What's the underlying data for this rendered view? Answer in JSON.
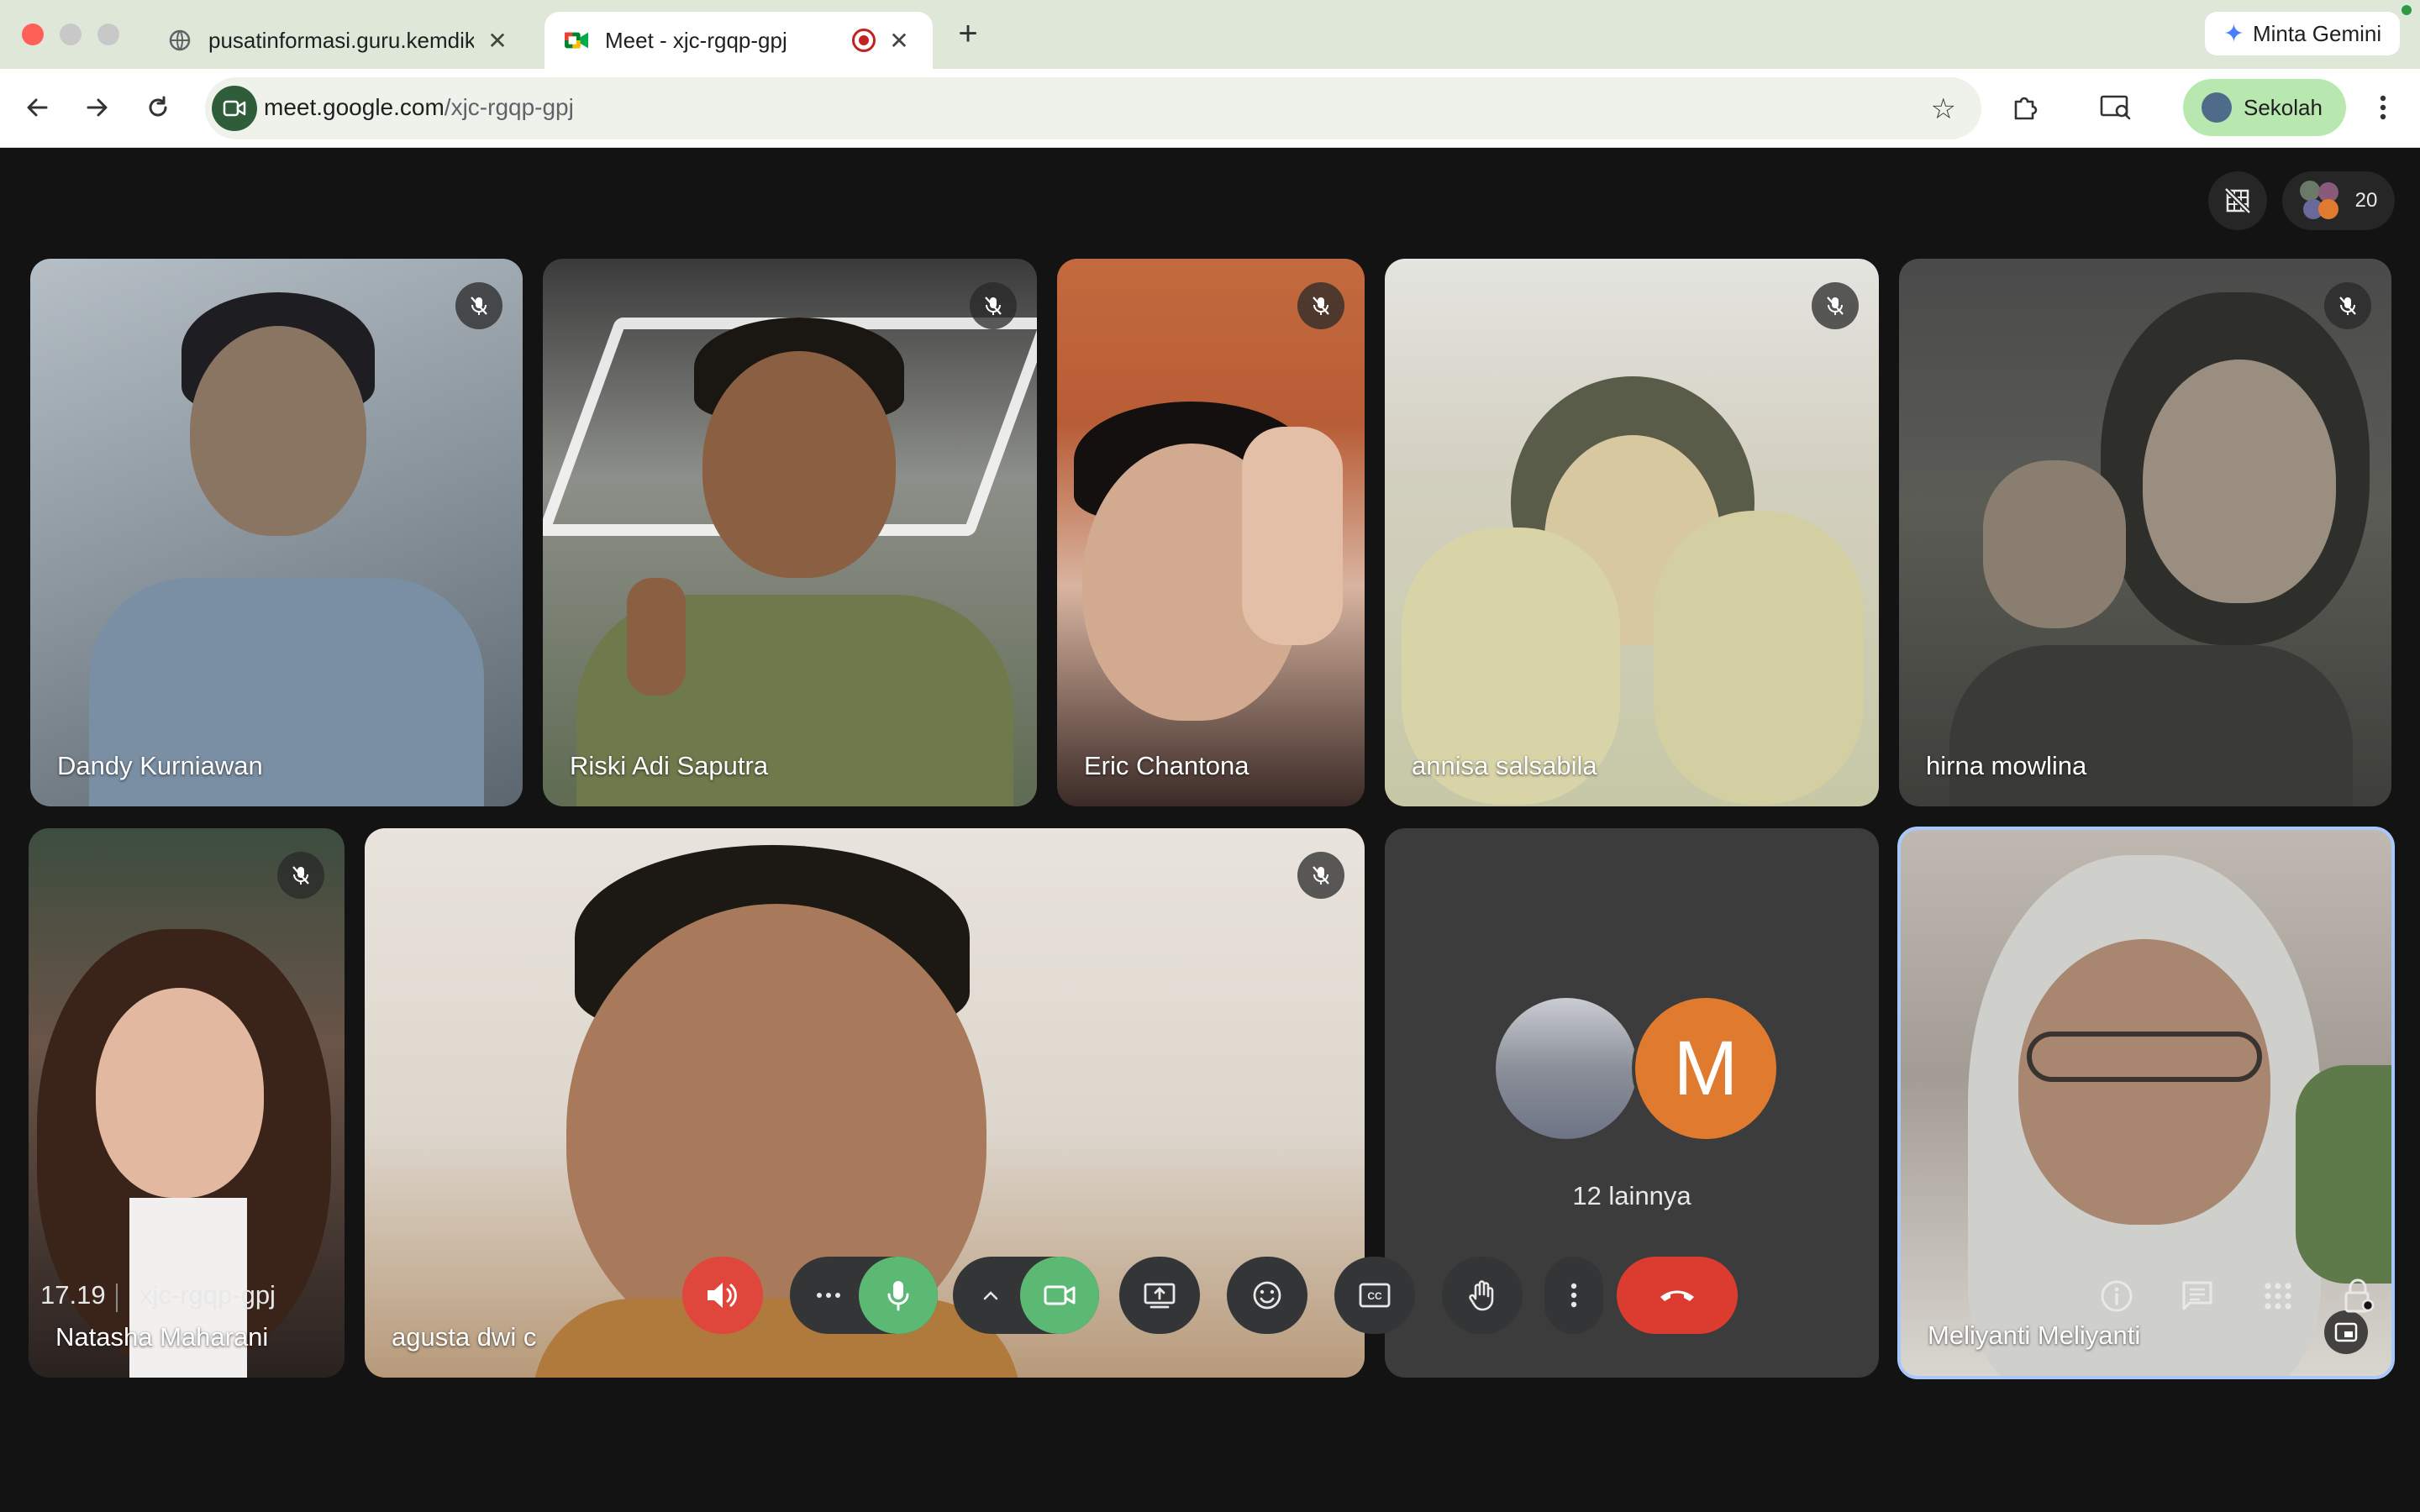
{
  "browser": {
    "tabs": [
      {
        "title": "pusatinformasi.guru.kemdikbud",
        "active": false
      },
      {
        "title": "Meet - xjc-rgqp-gpj",
        "active": true
      }
    ],
    "gemini_label": "Minta Gemini",
    "url_host": "meet.google.com",
    "url_path": "/xjc-rgqp-gpj",
    "profile_label": "Sekolah"
  },
  "meet": {
    "participant_count": "20",
    "tiles": [
      {
        "name": "Dandy Kurniawan",
        "muted": true
      },
      {
        "name": "Riski Adi Saputra",
        "muted": true
      },
      {
        "name": "Eric Chantona",
        "muted": true
      },
      {
        "name": "annisa salsabila",
        "muted": true
      },
      {
        "name": "hirna mowlina",
        "muted": true
      },
      {
        "name": "Natasha Maharani",
        "muted": true
      },
      {
        "name": "agusta dwi c",
        "muted": true
      },
      {
        "name": "Meliyanti Meliyanti",
        "muted": false
      }
    ],
    "others": {
      "avatar_letter": "M",
      "label": "12 lainnya"
    },
    "time": "17.19",
    "meeting_code": "xjc-rgqp-gpj"
  },
  "colors": {
    "accent_green": "#5bb974",
    "leave_red": "#dc3b2f",
    "speaker_red": "#e0473c",
    "avatar_orange": "#e07a2e",
    "active_border": "#a8c7fa"
  }
}
